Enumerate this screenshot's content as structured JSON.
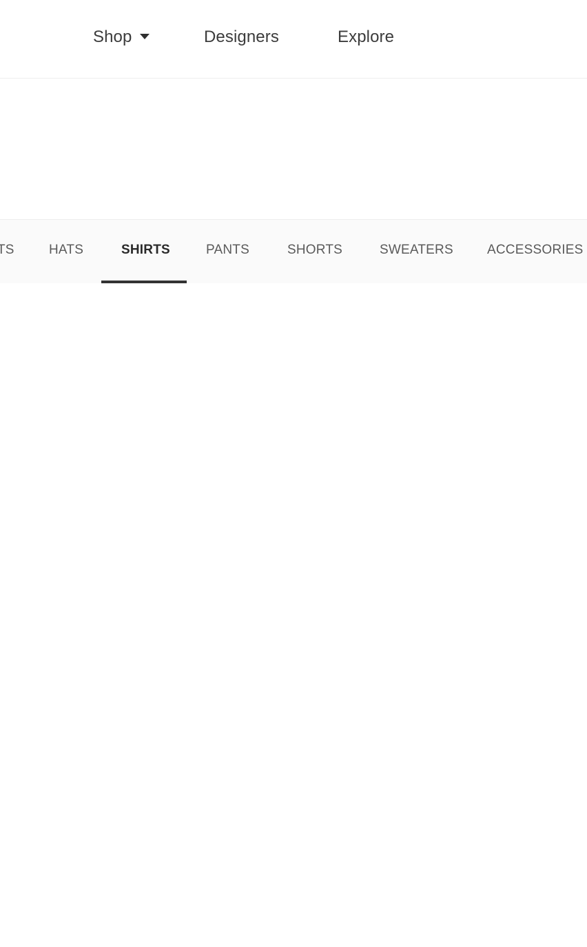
{
  "top_nav": {
    "shop_label": "Shop",
    "designers_label": "Designers",
    "explore_label": "Explore",
    "shop_icon": "caret-down-icon"
  },
  "category_tabs": {
    "items": [
      {
        "label": "TS"
      },
      {
        "label": "HATS"
      },
      {
        "label": "SHIRTS"
      },
      {
        "label": "PANTS"
      },
      {
        "label": "SHORTS"
      },
      {
        "label": "SWEATERS"
      },
      {
        "label": "ACCESSORIES"
      }
    ],
    "active": "SHIRTS"
  },
  "colors": {
    "text": "#3c3c3c",
    "tab_text": "#5a5a5a",
    "active_tab_text": "#2a2a2a",
    "underline": "#333333",
    "tab_bar_bg": "#fafafa",
    "page_bg": "#ffffff"
  }
}
